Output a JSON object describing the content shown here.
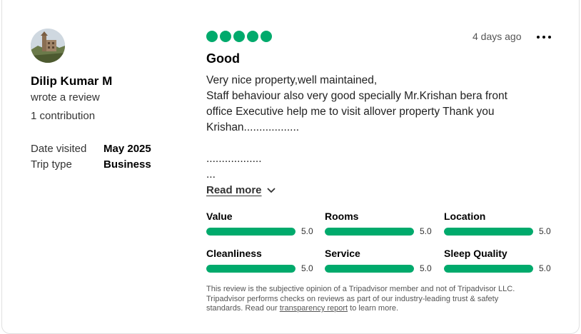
{
  "reviewer": {
    "name": "Dilip Kumar M",
    "action": "wrote a review",
    "contributions": "1 contribution",
    "date_visited_label": "Date visited",
    "date_visited": "May 2025",
    "trip_type_label": "Trip type",
    "trip_type": "Business"
  },
  "review": {
    "rating": 5,
    "date": "4 days ago",
    "title": "Good",
    "lines": [
      "Very nice property,well maintained,",
      "Staff behaviour also very good specially Mr.Krishan bera front",
      "office Executive help me to visit allover property Thank you",
      "Krishan..................",
      "",
      "..................",
      "..."
    ],
    "read_more": "Read more"
  },
  "sub_ratings": [
    {
      "label": "Value",
      "value": "5.0",
      "score": 5.0
    },
    {
      "label": "Rooms",
      "value": "5.0",
      "score": 5.0
    },
    {
      "label": "Location",
      "value": "5.0",
      "score": 5.0
    },
    {
      "label": "Cleanliness",
      "value": "5.0",
      "score": 5.0
    },
    {
      "label": "Service",
      "value": "5.0",
      "score": 5.0
    },
    {
      "label": "Sleep Quality",
      "value": "5.0",
      "score": 5.0
    }
  ],
  "disclaimer": {
    "line1": "This review is the subjective opinion of a Tripadvisor member and not of Tripadvisor LLC.",
    "line2": "Tripadvisor performs checks on reviews as part of our industry-leading trust & safety",
    "line3_pre": "standards. Read our ",
    "link": "transparency report",
    "line3_post": " to learn more."
  },
  "colors": {
    "accent": "#00aa6c",
    "track": "#e0e0e0"
  },
  "icons": {
    "menu": "more-horizontal-icon",
    "expand": "chevron-down-icon"
  }
}
